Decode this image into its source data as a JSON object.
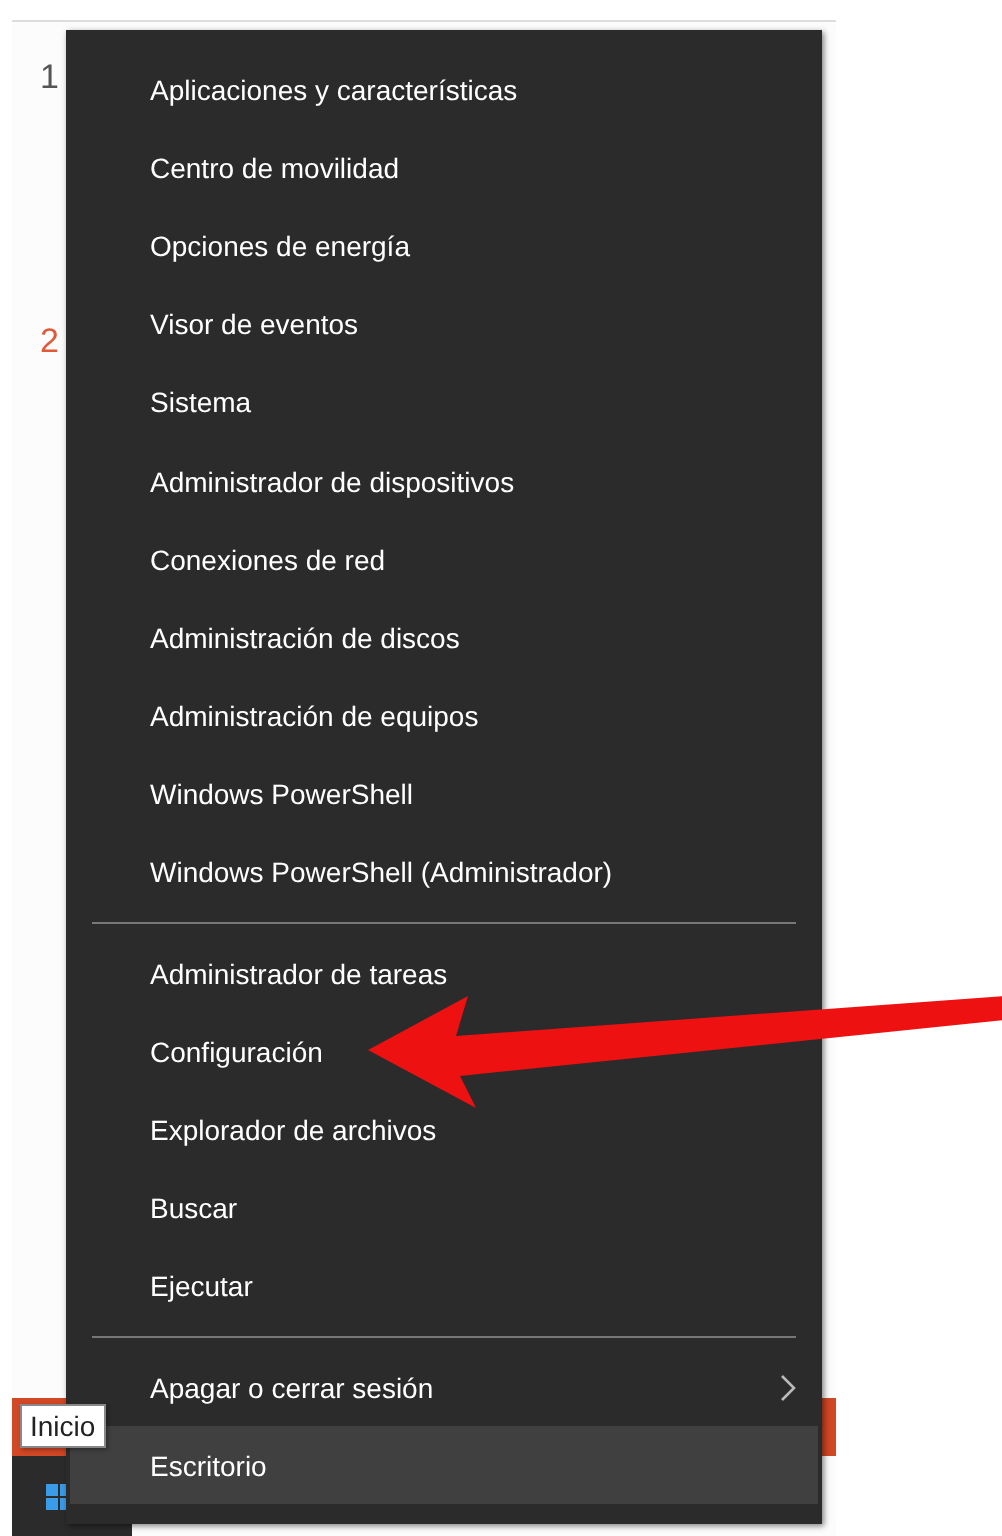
{
  "background": {
    "row_numbers": [
      {
        "text": "1",
        "color": "#555555"
      },
      {
        "text": "2",
        "color": "#e05a3a"
      }
    ]
  },
  "context_menu": {
    "groups": [
      {
        "items": [
          {
            "label": "Aplicaciones y características",
            "kind": "plain",
            "selected": false
          },
          {
            "label": "Centro de movilidad",
            "kind": "plain",
            "selected": false
          },
          {
            "label": "Opciones de energía",
            "kind": "plain",
            "selected": false
          },
          {
            "label": "Visor de eventos",
            "kind": "plain",
            "selected": false
          },
          {
            "label": "Sistema",
            "kind": "plain",
            "selected": false
          },
          {
            "label": "Administrador de dispositivos",
            "kind": "plain",
            "selected": false
          },
          {
            "label": "Conexiones de red",
            "kind": "plain",
            "selected": false
          },
          {
            "label": "Administración de discos",
            "kind": "plain",
            "selected": false
          },
          {
            "label": "Administración de equipos",
            "kind": "plain",
            "selected": false
          },
          {
            "label": "Windows PowerShell",
            "kind": "plain",
            "selected": false
          },
          {
            "label": "Windows PowerShell (Administrador)",
            "kind": "plain",
            "selected": false
          }
        ]
      },
      {
        "items": [
          {
            "label": "Administrador de tareas",
            "kind": "plain",
            "selected": false
          },
          {
            "label": "Configuración",
            "kind": "plain",
            "selected": false
          },
          {
            "label": "Explorador de archivos",
            "kind": "plain",
            "selected": false
          },
          {
            "label": "Buscar",
            "kind": "plain",
            "selected": false
          },
          {
            "label": "Ejecutar",
            "kind": "plain",
            "selected": false
          }
        ]
      },
      {
        "items": [
          {
            "label": "Apagar o cerrar sesión",
            "kind": "submenu",
            "selected": false
          },
          {
            "label": "Escritorio",
            "kind": "plain",
            "selected": true
          }
        ]
      }
    ]
  },
  "tooltip": {
    "text": "Inicio"
  }
}
